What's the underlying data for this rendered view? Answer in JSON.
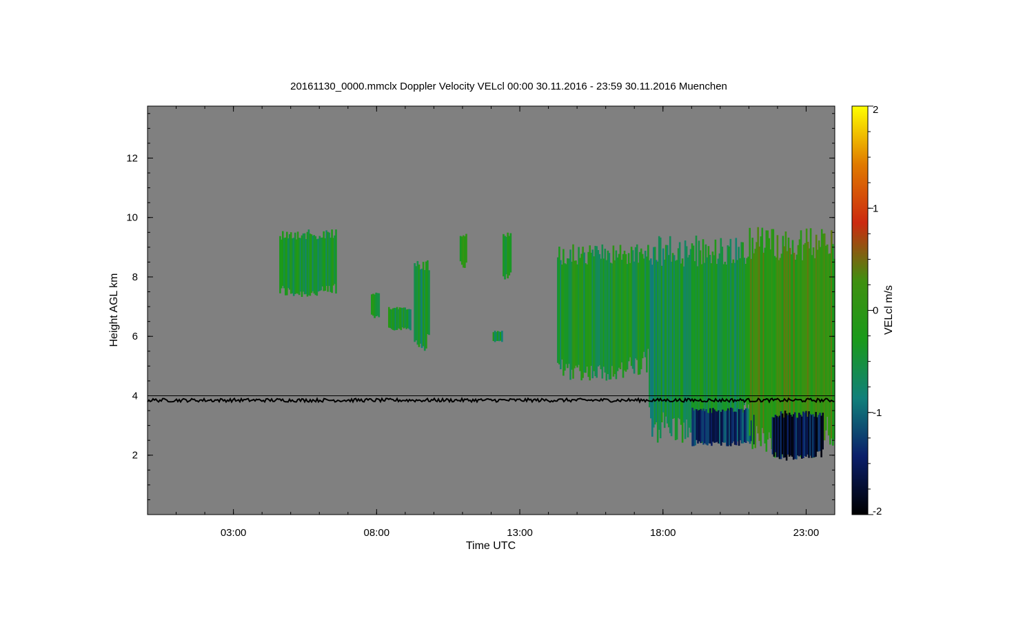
{
  "chart_data": {
    "type": "heatmap",
    "title": "20161130_0000.mmclx Doppler Velocity VELcl   00:00 30.11.2016 - 23:59 30.11.2016 Muenchen",
    "xlabel": "Time UTC",
    "ylabel": "Height AGL km",
    "colorbar_label": "VELcl m/s",
    "x_range_hours": [
      0.0,
      24.0
    ],
    "y_range_km": [
      0.0,
      13.75
    ],
    "x_ticks": [
      {
        "value": 3,
        "label": "03:00"
      },
      {
        "value": 8,
        "label": "08:00"
      },
      {
        "value": 13,
        "label": "13:00"
      },
      {
        "value": 18,
        "label": "18:00"
      },
      {
        "value": 23,
        "label": "23:00"
      }
    ],
    "y_ticks": [
      {
        "value": 2,
        "label": "2"
      },
      {
        "value": 4,
        "label": "4"
      },
      {
        "value": 6,
        "label": "6"
      },
      {
        "value": 8,
        "label": "8"
      },
      {
        "value": 10,
        "label": "10"
      },
      {
        "value": 12,
        "label": "12"
      }
    ],
    "colorbar_range": [
      -2,
      2
    ],
    "colorbar_ticks": [
      {
        "value": 2,
        "label": "2"
      },
      {
        "value": 1,
        "label": "1"
      },
      {
        "value": 0,
        "label": "0"
      },
      {
        "value": -1,
        "label": "-1"
      },
      {
        "value": -2,
        "label": "-2"
      }
    ],
    "colormap": [
      "#000000",
      "#0b1f6a",
      "#11807a",
      "#1a9a1a",
      "#3f9010",
      "#cc2a10",
      "#e07a00",
      "#ffff00"
    ],
    "background_color": "#808080",
    "melting_layer_km": 3.85,
    "melting_layer_color": "#000000",
    "echo_regions": [
      {
        "t_start": 4.6,
        "t_end": 6.6,
        "base_km": 7.3,
        "top_km": 9.6,
        "velocity": -0.4
      },
      {
        "t_start": 7.8,
        "t_end": 8.1,
        "base_km": 6.6,
        "top_km": 7.5,
        "velocity": -0.4
      },
      {
        "t_start": 8.4,
        "t_end": 9.2,
        "base_km": 6.2,
        "top_km": 7.0,
        "velocity": -0.45
      },
      {
        "t_start": 9.3,
        "t_end": 9.85,
        "base_km": 5.5,
        "top_km": 8.7,
        "velocity": -0.5
      },
      {
        "t_start": 10.9,
        "t_end": 11.15,
        "base_km": 8.3,
        "top_km": 9.5,
        "velocity": -0.2
      },
      {
        "t_start": 12.05,
        "t_end": 12.4,
        "base_km": 5.8,
        "top_km": 6.2,
        "velocity": -0.5
      },
      {
        "t_start": 12.4,
        "t_end": 12.7,
        "base_km": 7.9,
        "top_km": 9.5,
        "velocity": -0.3
      },
      {
        "t_start": 14.3,
        "t_end": 17.5,
        "base_km": 4.5,
        "top_km": 9.1,
        "velocity": -0.35
      },
      {
        "t_start": 17.5,
        "t_end": 21.0,
        "base_km": 2.4,
        "top_km": 9.4,
        "velocity": -0.5
      },
      {
        "t_start": 19.0,
        "t_end": 21.2,
        "base_km": 2.3,
        "top_km": 3.6,
        "velocity": -1.3
      },
      {
        "t_start": 21.0,
        "t_end": 24.0,
        "base_km": 1.9,
        "top_km": 9.7,
        "velocity": 0.1
      },
      {
        "t_start": 21.8,
        "t_end": 23.6,
        "base_km": 1.8,
        "top_km": 3.5,
        "velocity": -1.6
      }
    ]
  }
}
